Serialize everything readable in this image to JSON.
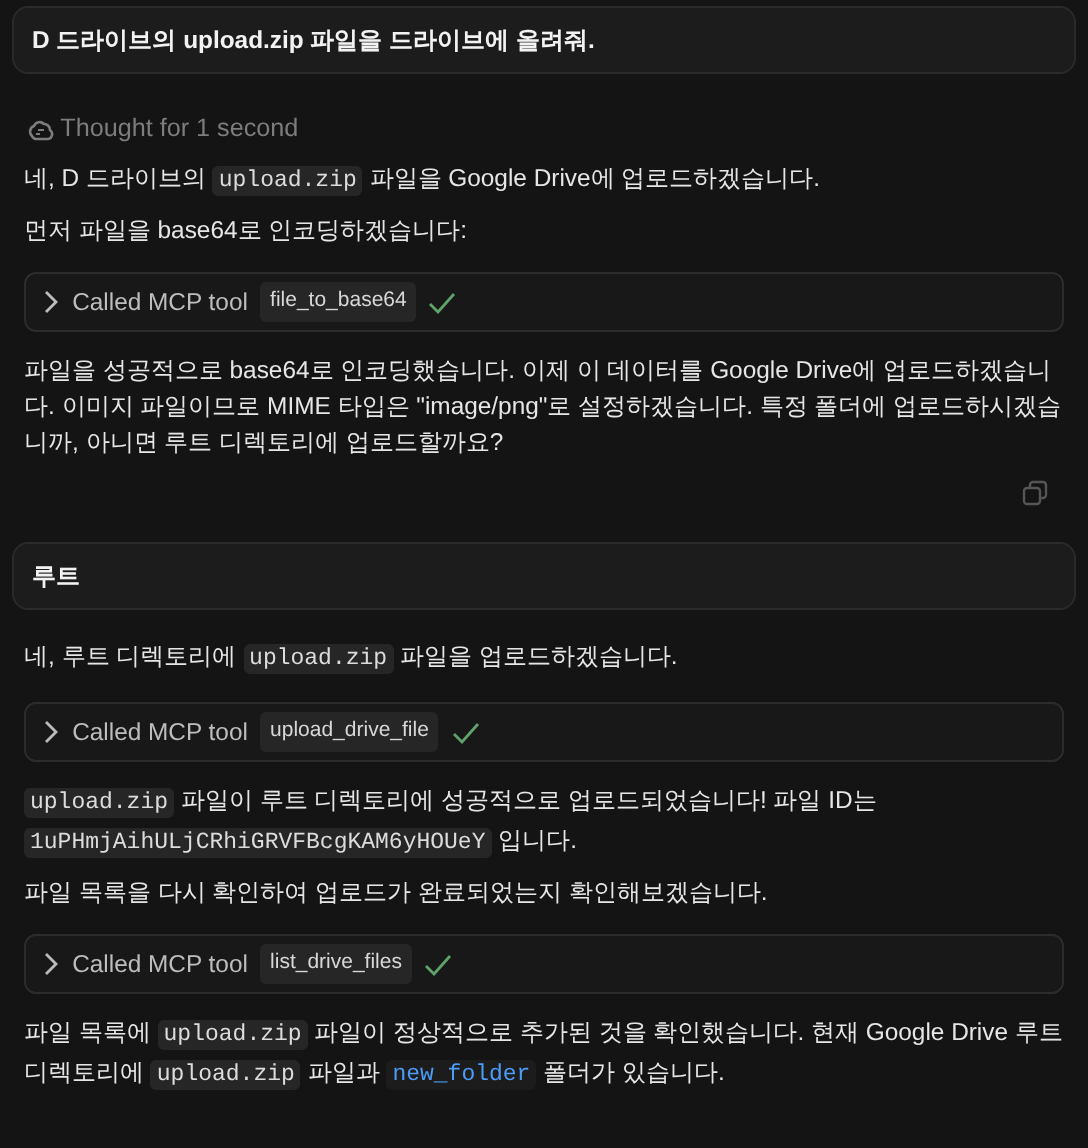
{
  "messages": [
    {
      "kind": "user",
      "text": "D 드라이브의 upload.zip 파일을 드라이브에 올려줘."
    },
    {
      "kind": "thought",
      "text": "Thought for 1 second"
    },
    {
      "kind": "paragraph",
      "segments": [
        {
          "kind": "text",
          "text": "네, D 드라이브의 "
        },
        {
          "kind": "code",
          "text": "upload.zip"
        },
        {
          "kind": "text",
          "text": " 파일을 Google Drive에 업로드하겠습니다."
        }
      ]
    },
    {
      "kind": "paragraph",
      "segments": [
        {
          "kind": "text",
          "text": "먼저 파일을 base64로 인코딩하겠습니다:"
        }
      ]
    },
    {
      "kind": "tool",
      "label": "Called MCP tool",
      "tool": "file_to_base64",
      "expanded": false,
      "done": true
    },
    {
      "kind": "paragraph",
      "segments": [
        {
          "kind": "text",
          "text": "파일을 성공적으로 base64로 인코딩했습니다. 이제 이 데이터를 Google Drive에 업로드하겠습니다. 이미지 파일이므로 MIME 타입은 \"image/png\"로 설정하겠습니다. 특정 폴더에 업로드하시겠습니까, 아니면 루트 디렉토리에 업로드할까요?"
        }
      ]
    },
    {
      "kind": "copy"
    },
    {
      "kind": "user",
      "text": "루트"
    },
    {
      "kind": "paragraph",
      "segments": [
        {
          "kind": "text",
          "text": "네, 루트 디렉토리에 "
        },
        {
          "kind": "code",
          "text": "upload.zip"
        },
        {
          "kind": "text",
          "text": " 파일을 업로드하겠습니다."
        }
      ]
    },
    {
      "kind": "tool",
      "label": "Called MCP tool",
      "tool": "upload_drive_file",
      "expanded": false,
      "done": true
    },
    {
      "kind": "paragraph",
      "segments": [
        {
          "kind": "code",
          "text": "upload.zip"
        },
        {
          "kind": "text",
          "text": " 파일이 루트 디렉토리에 성공적으로 업로드되었습니다! 파일 ID는 "
        },
        {
          "kind": "code",
          "text": "1uPHmjAihULjCRhiGRVFBcgKAM6yHOUeY"
        },
        {
          "kind": "text",
          "text": " 입니다."
        }
      ]
    },
    {
      "kind": "paragraph",
      "segments": [
        {
          "kind": "text",
          "text": "파일 목록을 다시 확인하여 업로드가 완료되었는지 확인해보겠습니다."
        }
      ]
    },
    {
      "kind": "tool",
      "label": "Called MCP tool",
      "tool": "list_drive_files",
      "expanded": false,
      "done": true
    },
    {
      "kind": "paragraph",
      "segments": [
        {
          "kind": "text",
          "text": "파일 목록에 "
        },
        {
          "kind": "code",
          "text": "upload.zip"
        },
        {
          "kind": "text",
          "text": " 파일이 정상적으로 추가된 것을 확인했습니다. 현재 Google Drive 루트 디렉토리에 "
        },
        {
          "kind": "code",
          "text": "upload.zip"
        },
        {
          "kind": "text",
          "text": " 파일과 "
        },
        {
          "kind": "link",
          "text": "new_folder"
        },
        {
          "kind": "text",
          "text": " 폴더가 있습니다."
        }
      ]
    }
  ]
}
